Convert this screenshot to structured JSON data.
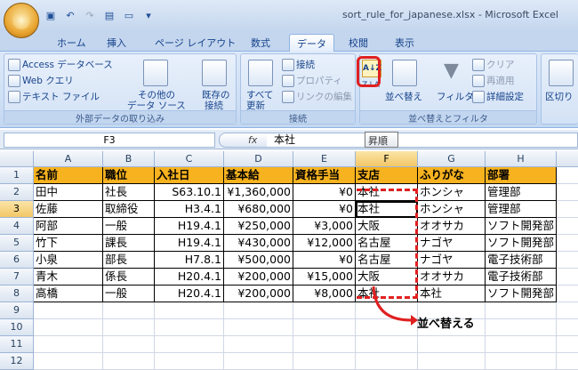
{
  "window": {
    "title": "sort_rule_for_japanese.xlsx - Microsoft Excel"
  },
  "tabs": [
    "ホーム",
    "挿入",
    "ページ レイアウト",
    "数式",
    "データ",
    "校閲",
    "表示"
  ],
  "ribbon": {
    "external": {
      "title": "外部データの取り込み",
      "access": "Access データベース",
      "web": "Web クエリ",
      "text": "テキスト ファイル",
      "other_line1": "その他の",
      "other_line2": "データ ソース",
      "existing_line1": "既存の",
      "existing_line2": "接続"
    },
    "connections": {
      "title": "接続",
      "refresh_line1": "すべて",
      "refresh_line2": "更新",
      "connect": "接続",
      "props": "プロパティ",
      "links": "リンクの編集"
    },
    "sortfilter": {
      "title": "並べ替えとフィルタ",
      "sort": "並べ替え",
      "filter": "フィルタ",
      "clear": "クリア",
      "reapply": "再適用",
      "advanced": "詳細設定",
      "az": "A↓Z",
      "za": "Z↓A"
    },
    "tools": {
      "split": "区切り"
    }
  },
  "formula": {
    "namebox": "F3",
    "fx": "fx",
    "value": "本社",
    "tooltip": "昇順"
  },
  "columns": [
    "A",
    "B",
    "C",
    "D",
    "E",
    "F",
    "G",
    "H"
  ],
  "rows": [
    "1",
    "2",
    "3",
    "4",
    "5",
    "6",
    "7",
    "8",
    "9",
    "10",
    "11",
    "12"
  ],
  "table": {
    "headers": [
      "名前",
      "職位",
      "入社日",
      "基本給",
      "資格手当",
      "支店",
      "ふりがな",
      "部署"
    ],
    "data": [
      [
        "田中",
        "社長",
        "S63.10.1",
        "¥1,360,000",
        "¥0",
        "本社",
        "ホンシャ",
        "管理部"
      ],
      [
        "佐藤",
        "取締役",
        "H3.4.1",
        "¥680,000",
        "¥0",
        "本社",
        "ホンシャ",
        "管理部"
      ],
      [
        "阿部",
        "一般",
        "H19.4.1",
        "¥250,000",
        "¥3,000",
        "大阪",
        "オオサカ",
        "ソフト開発部"
      ],
      [
        "竹下",
        "課長",
        "H19.4.1",
        "¥430,000",
        "¥12,000",
        "名古屋",
        "ナゴヤ",
        "ソフト開発部"
      ],
      [
        "小泉",
        "部長",
        "H7.8.1",
        "¥500,000",
        "¥0",
        "名古屋",
        "ナゴヤ",
        "電子技術部"
      ],
      [
        "青木",
        "係長",
        "H20.4.1",
        "¥200,000",
        "¥15,000",
        "大阪",
        "オオサカ",
        "電子技術部"
      ],
      [
        "高橋",
        "一般",
        "H20.4.1",
        "¥200,000",
        "¥8,000",
        "本社",
        "本社",
        "ソフト開発部"
      ]
    ]
  },
  "annotation": {
    "label": "並べ替える"
  },
  "colors": {
    "header_fill": "#f7b21f",
    "highlight": "#e02020"
  }
}
